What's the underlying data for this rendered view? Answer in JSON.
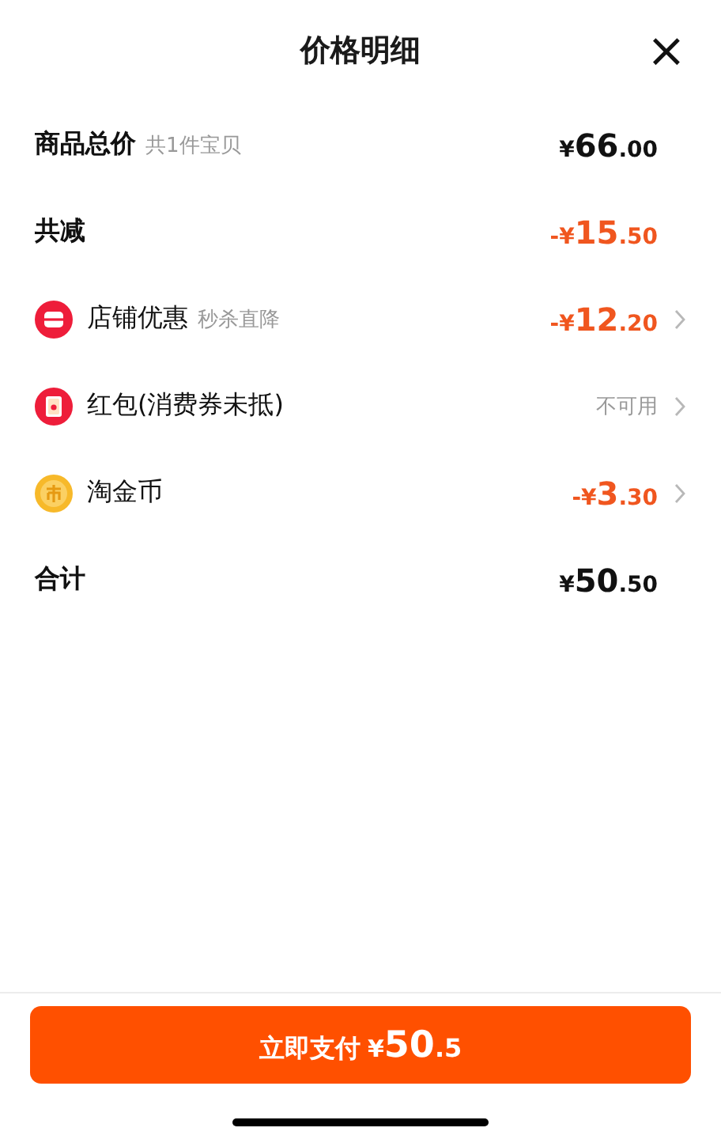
{
  "header": {
    "title": "价格明细",
    "close": "×"
  },
  "rows": [
    {
      "kind": "summary",
      "label": "商品总价",
      "note": "共1件宝贝",
      "price": {
        "prefix": "¥",
        "main": "66",
        "fraction": ".00"
      },
      "discount": false,
      "arrow": false
    },
    {
      "kind": "summary",
      "label": "共减",
      "price": {
        "prefix": "-¥",
        "main": "15",
        "fraction": ".50"
      },
      "discount": true,
      "arrow": false
    },
    {
      "kind": "shop",
      "label": "店铺优惠",
      "note": "秒杀直降",
      "price": {
        "prefix": "-¥",
        "main": "12",
        "fraction": ".20"
      },
      "discount": true,
      "arrow": true
    },
    {
      "kind": "envelope",
      "label": "红包(消费券未抵)",
      "status": "不可用",
      "arrow": true
    },
    {
      "kind": "coin",
      "label": "淘金币",
      "price": {
        "prefix": "-¥",
        "main": "3",
        "fraction": ".30"
      },
      "discount": true,
      "arrow": true
    },
    {
      "kind": "summary",
      "label": "合计",
      "price": {
        "prefix": "¥",
        "main": "50",
        "fraction": ".50"
      },
      "discount": false,
      "arrow": false
    }
  ],
  "pay_button": {
    "label": "立即支付",
    "prefix": "¥",
    "main": "50",
    "fraction": ".5"
  }
}
